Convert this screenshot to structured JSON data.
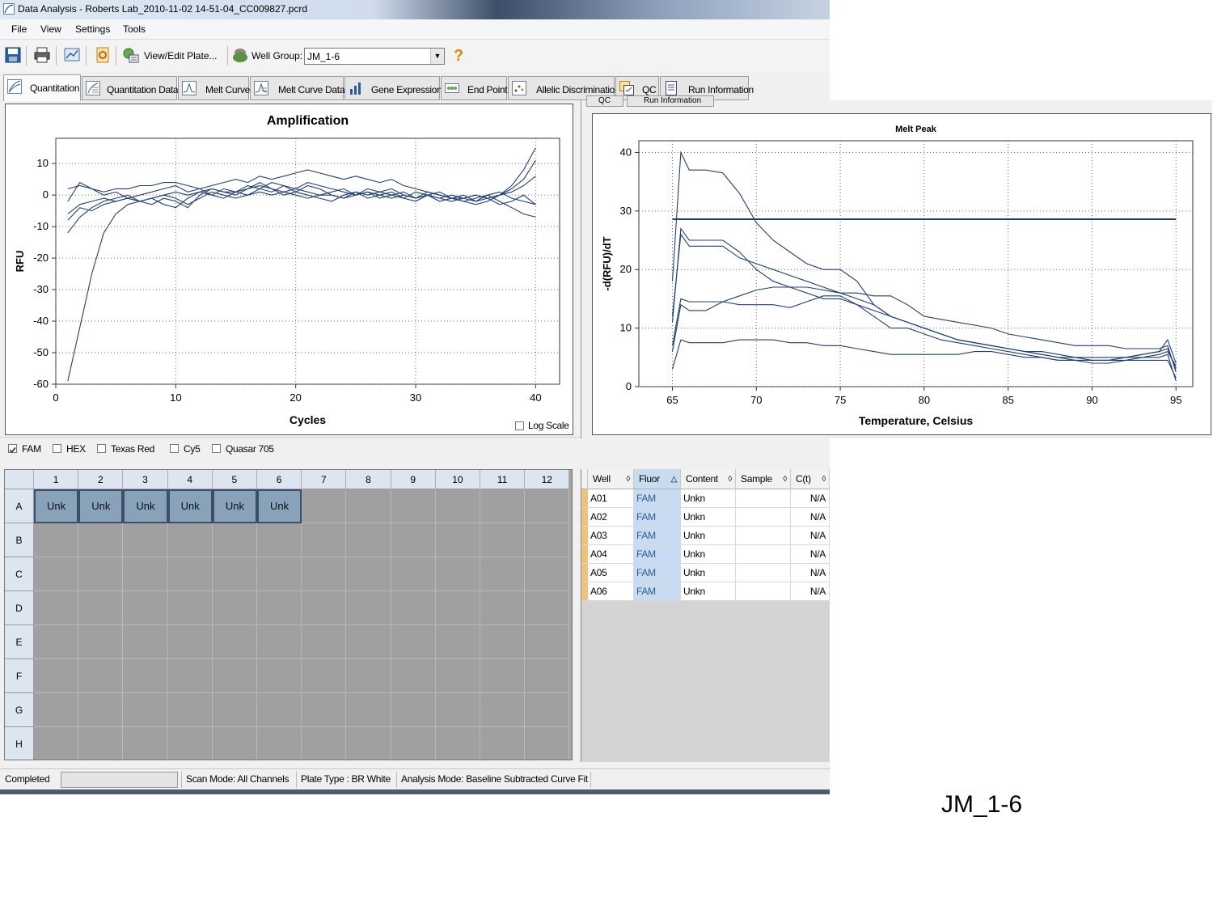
{
  "window": {
    "title": "Data Analysis - Roberts Lab_2010-11-02 14-51-04_CC009827.pcrd"
  },
  "menu": [
    "File",
    "View",
    "Settings",
    "Tools"
  ],
  "toolbar": {
    "view_edit_label": "View/Edit Plate...",
    "well_group_label": "Well Group:",
    "well_group_value": "JM_1-6",
    "help_label": "?"
  },
  "tabs": [
    {
      "label": "Quantitation",
      "active": true
    },
    {
      "label": "Quantitation Data"
    },
    {
      "label": "Melt Curve"
    },
    {
      "label": "Melt Curve Data"
    },
    {
      "label": "Gene Expression"
    },
    {
      "label": "End Point"
    },
    {
      "label": "Allelic Discrimination"
    },
    {
      "label": "QC"
    },
    {
      "label": "Run Information"
    }
  ],
  "behind_tabs": [
    "QC",
    "Run Information"
  ],
  "log_scale_label": "Log Scale",
  "fluorophores": [
    {
      "label": "FAM",
      "checked": true
    },
    {
      "label": "HEX",
      "checked": false
    },
    {
      "label": "Texas Red",
      "checked": false
    },
    {
      "label": "Cy5",
      "checked": false
    },
    {
      "label": "Quasar 705",
      "checked": false
    }
  ],
  "plate": {
    "columns": [
      "1",
      "2",
      "3",
      "4",
      "5",
      "6",
      "7",
      "8",
      "9",
      "10",
      "11",
      "12"
    ],
    "rows": [
      "A",
      "B",
      "C",
      "D",
      "E",
      "F",
      "G",
      "H"
    ],
    "filled": [
      {
        "row": "A",
        "col": "1",
        "label": "Unk"
      },
      {
        "row": "A",
        "col": "2",
        "label": "Unk"
      },
      {
        "row": "A",
        "col": "3",
        "label": "Unk"
      },
      {
        "row": "A",
        "col": "4",
        "label": "Unk"
      },
      {
        "row": "A",
        "col": "5",
        "label": "Unk"
      },
      {
        "row": "A",
        "col": "6",
        "label": "Unk"
      }
    ]
  },
  "well_table": {
    "headers": [
      "Well",
      "Fluor",
      "Content",
      "Sample",
      "C(t)"
    ],
    "rows": [
      {
        "well": "A01",
        "fluor": "FAM",
        "content": "Unkn",
        "sample": "",
        "ct": "N/A"
      },
      {
        "well": "A02",
        "fluor": "FAM",
        "content": "Unkn",
        "sample": "",
        "ct": "N/A"
      },
      {
        "well": "A03",
        "fluor": "FAM",
        "content": "Unkn",
        "sample": "",
        "ct": "N/A"
      },
      {
        "well": "A04",
        "fluor": "FAM",
        "content": "Unkn",
        "sample": "",
        "ct": "N/A"
      },
      {
        "well": "A05",
        "fluor": "FAM",
        "content": "Unkn",
        "sample": "",
        "ct": "N/A"
      },
      {
        "well": "A06",
        "fluor": "FAM",
        "content": "Unkn",
        "sample": "",
        "ct": "N/A"
      }
    ]
  },
  "status": {
    "state": "Completed",
    "scan_mode": "Scan Mode: All Channels",
    "plate_type": "Plate Type : BR White",
    "analysis_mode": "Analysis Mode: Baseline Subtracted Curve Fit"
  },
  "caption": "JM_1-6",
  "colors": {
    "trace": "#1f3f73",
    "unk_cell": "#87a2b9",
    "fluor_cell": "#c7dcf0"
  },
  "chart_data": [
    {
      "type": "line",
      "title": "Amplification",
      "xlabel": "Cycles",
      "ylabel": "RFU",
      "xlim": [
        0,
        42
      ],
      "ylim": [
        -60,
        18
      ],
      "xticks": [
        0,
        10,
        20,
        30,
        40
      ],
      "yticks": [
        10,
        0,
        -10,
        -20,
        -30,
        -40,
        -50,
        -60
      ],
      "grid": true,
      "series": [
        {
          "x": [
            1,
            2,
            3,
            4,
            5,
            6,
            7,
            8,
            9,
            10,
            11,
            12,
            13,
            14,
            15,
            16,
            17,
            18,
            19,
            20,
            21,
            22,
            23,
            24,
            25,
            26,
            27,
            28,
            29,
            30,
            31,
            32,
            33,
            34,
            35,
            36,
            37,
            38,
            39,
            40
          ],
          "y": [
            -59,
            -42,
            -25,
            -12,
            -6,
            -3,
            -2,
            -1,
            0,
            1,
            0,
            1,
            2,
            1,
            1,
            0,
            1,
            0,
            1,
            0,
            -1,
            0,
            0,
            -1,
            0,
            1,
            0,
            -1,
            0,
            -1,
            0,
            -1,
            0,
            -1,
            -2,
            -1,
            0,
            3,
            8,
            15
          ]
        },
        {
          "x": [
            1,
            2,
            3,
            4,
            5,
            6,
            7,
            8,
            9,
            10,
            11,
            12,
            13,
            14,
            15,
            16,
            17,
            18,
            19,
            20,
            21,
            22,
            23,
            24,
            25,
            26,
            27,
            28,
            29,
            30,
            31,
            32,
            33,
            34,
            35,
            36,
            37,
            38,
            39,
            40
          ],
          "y": [
            2,
            3,
            2,
            1,
            2,
            2,
            3,
            3,
            4,
            4,
            3,
            2,
            3,
            4,
            5,
            4,
            6,
            5,
            6,
            7,
            8,
            7,
            6,
            5,
            6,
            5,
            4,
            5,
            3,
            2,
            1,
            0,
            -1,
            -1,
            0,
            -1,
            0,
            2,
            5,
            11
          ]
        },
        {
          "x": [
            1,
            2,
            3,
            4,
            5,
            6,
            7,
            8,
            9,
            10,
            11,
            12,
            13,
            14,
            15,
            16,
            17,
            18,
            19,
            20,
            21,
            22,
            23,
            24,
            25,
            26,
            27,
            28,
            29,
            30,
            31,
            32,
            33,
            34,
            35,
            36,
            37,
            38,
            39,
            40
          ],
          "y": [
            -12,
            -7,
            -4,
            -2,
            -1,
            0,
            -2,
            -1,
            -3,
            -4,
            -1,
            1,
            0,
            2,
            1,
            3,
            2,
            4,
            3,
            2,
            1,
            0,
            1,
            2,
            0,
            1,
            -1,
            0,
            1,
            -1,
            0,
            -2,
            -1,
            -2,
            -3,
            -2,
            0,
            1,
            3,
            6
          ]
        },
        {
          "x": [
            1,
            2,
            3,
            4,
            5,
            6,
            7,
            8,
            9,
            10,
            11,
            12,
            13,
            14,
            15,
            16,
            17,
            18,
            19,
            20,
            21,
            22,
            23,
            24,
            25,
            26,
            27,
            28,
            29,
            30,
            31,
            32,
            33,
            34,
            35,
            36,
            37,
            38,
            39,
            40
          ],
          "y": [
            -6,
            -3,
            -2,
            -1,
            -2,
            -1,
            0,
            1,
            2,
            3,
            1,
            2,
            0,
            -1,
            1,
            2,
            3,
            2,
            1,
            2,
            4,
            3,
            2,
            1,
            0,
            2,
            1,
            0,
            -1,
            1,
            0,
            -1,
            -2,
            -1,
            0,
            -1,
            -3,
            -2,
            0,
            -3
          ]
        },
        {
          "x": [
            1,
            2,
            3,
            4,
            5,
            6,
            7,
            8,
            9,
            10,
            11,
            12,
            13,
            14,
            15,
            16,
            17,
            18,
            19,
            20,
            21,
            22,
            23,
            24,
            25,
            26,
            27,
            28,
            29,
            30,
            31,
            32,
            33,
            34,
            35,
            36,
            37,
            38,
            39,
            40
          ],
          "y": [
            -8,
            -4,
            -5,
            -3,
            -2,
            -1,
            -2,
            -3,
            -1,
            -2,
            -4,
            0,
            2,
            1,
            0,
            2,
            4,
            2,
            0,
            1,
            3,
            2,
            0,
            -1,
            1,
            0,
            1,
            2,
            0,
            -1,
            1,
            0,
            -1,
            -2,
            -1,
            0,
            -2,
            -4,
            -6,
            -7
          ]
        },
        {
          "x": [
            1,
            2,
            3,
            4,
            5,
            6,
            7,
            8,
            9,
            10,
            11,
            12,
            13,
            14,
            15,
            16,
            17,
            18,
            19,
            20,
            21,
            22,
            23,
            24,
            25,
            26,
            27,
            28,
            29,
            30,
            31,
            32,
            33,
            34,
            35,
            36,
            37,
            38,
            39,
            40
          ],
          "y": [
            -2,
            4,
            2,
            0,
            1,
            -1,
            -2,
            -1,
            0,
            -1,
            -3,
            -1,
            1,
            0,
            -1,
            0,
            2,
            1,
            3,
            1,
            0,
            -1,
            -2,
            0,
            1,
            -1,
            0,
            1,
            -1,
            -2,
            0,
            1,
            -1,
            0,
            -2,
            0,
            1,
            -1,
            -2,
            -3
          ]
        }
      ]
    },
    {
      "type": "line",
      "title": "Melt Peak",
      "xlabel": "Temperature, Celsius",
      "ylabel": "-d(RFU)/dT",
      "xlim": [
        63,
        96
      ],
      "ylim": [
        0,
        42
      ],
      "xticks": [
        65,
        70,
        75,
        80,
        85,
        90,
        95
      ],
      "yticks": [
        0,
        10,
        20,
        30,
        40
      ],
      "grid": true,
      "threshold": {
        "y": 28.6,
        "x_range": [
          65,
          95
        ]
      },
      "series": [
        {
          "x": [
            65,
            65.5,
            66,
            67,
            68,
            69,
            70,
            71,
            72,
            73,
            74,
            75,
            76,
            77,
            78,
            79,
            80,
            81,
            82,
            83,
            84,
            85,
            86,
            87,
            88,
            89,
            90,
            91,
            92,
            93,
            94,
            94.5,
            95
          ],
          "y": [
            18,
            40,
            37,
            37,
            36.5,
            33,
            28,
            25,
            23,
            21,
            20,
            20,
            18,
            14,
            12,
            11,
            10,
            9,
            8,
            7.5,
            7,
            6.5,
            6,
            5.5,
            5,
            5,
            4.5,
            4.5,
            4.5,
            4.5,
            4.5,
            4.5,
            1.5
          ]
        },
        {
          "x": [
            65,
            65.5,
            66,
            67,
            68,
            69,
            70,
            71,
            72,
            73,
            74,
            75,
            76,
            77,
            78,
            79,
            80,
            81,
            82,
            83,
            84,
            85,
            86,
            87,
            88,
            89,
            90,
            91,
            92,
            93,
            94,
            94.5,
            95
          ],
          "y": [
            11,
            27,
            25,
            25,
            25,
            23,
            20,
            18,
            17,
            16,
            15,
            15,
            14,
            13,
            12,
            11,
            10,
            9,
            8,
            7.5,
            7,
            6.5,
            6,
            6,
            5.5,
            5,
            5,
            5,
            5,
            5.5,
            6,
            6.5,
            3
          ]
        },
        {
          "x": [
            65,
            65.5,
            66,
            67,
            68,
            69,
            70,
            71,
            72,
            73,
            74,
            75,
            76,
            77,
            78,
            79,
            80,
            81,
            82,
            83,
            84,
            85,
            86,
            87,
            88,
            89,
            90,
            91,
            92,
            93,
            94,
            94.5,
            95
          ],
          "y": [
            12,
            26,
            24,
            24,
            24,
            22,
            21,
            20,
            19,
            18,
            17,
            16,
            15,
            14,
            12,
            11,
            10,
            9,
            8,
            7.5,
            7,
            6.5,
            6,
            5.5,
            5,
            4.5,
            4.5,
            4.5,
            5,
            5,
            5.5,
            6,
            3.5
          ]
        },
        {
          "x": [
            65,
            65.5,
            66,
            67,
            68,
            69,
            70,
            71,
            72,
            73,
            74,
            75,
            76,
            77,
            78,
            79,
            80,
            81,
            82,
            83,
            84,
            85,
            86,
            87,
            88,
            89,
            90,
            91,
            92,
            93,
            94,
            94.5,
            95
          ],
          "y": [
            7,
            15,
            14.5,
            14.5,
            14.5,
            14,
            14,
            14,
            13.5,
            14.5,
            15.5,
            15.5,
            14,
            12,
            10,
            10,
            9,
            8,
            7.5,
            7,
            6.5,
            6,
            5.5,
            5,
            4.5,
            4.5,
            4.5,
            4.5,
            5,
            5.5,
            6,
            8,
            4
          ]
        },
        {
          "x": [
            65,
            65.5,
            66,
            67,
            68,
            69,
            70,
            71,
            72,
            73,
            74,
            75,
            76,
            77,
            78,
            79,
            80,
            81,
            82,
            83,
            84,
            85,
            86,
            87,
            88,
            89,
            90,
            91,
            92,
            93,
            94,
            94.5,
            95
          ],
          "y": [
            6,
            14,
            13,
            13,
            14.5,
            15.5,
            16.5,
            17,
            17,
            17,
            16.5,
            16,
            16,
            15.5,
            15.5,
            14,
            12,
            11.5,
            11,
            10.5,
            10,
            9,
            8.5,
            8,
            7.5,
            7,
            7,
            7,
            6.5,
            6.5,
            6.5,
            7,
            2.5
          ]
        },
        {
          "x": [
            65,
            65.5,
            66,
            67,
            68,
            69,
            70,
            71,
            72,
            73,
            74,
            75,
            76,
            77,
            78,
            79,
            80,
            81,
            82,
            83,
            84,
            85,
            86,
            87,
            88,
            89,
            90,
            91,
            92,
            93,
            94,
            94.5,
            95
          ],
          "y": [
            3,
            8,
            7.5,
            7.5,
            7.5,
            8,
            8,
            8,
            7.5,
            7.5,
            7,
            7,
            6.5,
            6,
            5.5,
            5.5,
            5.5,
            5.5,
            5.5,
            6,
            6,
            5.5,
            5,
            5,
            4.5,
            4.5,
            4,
            4,
            4.5,
            5,
            5,
            5.5,
            1
          ]
        }
      ]
    }
  ]
}
